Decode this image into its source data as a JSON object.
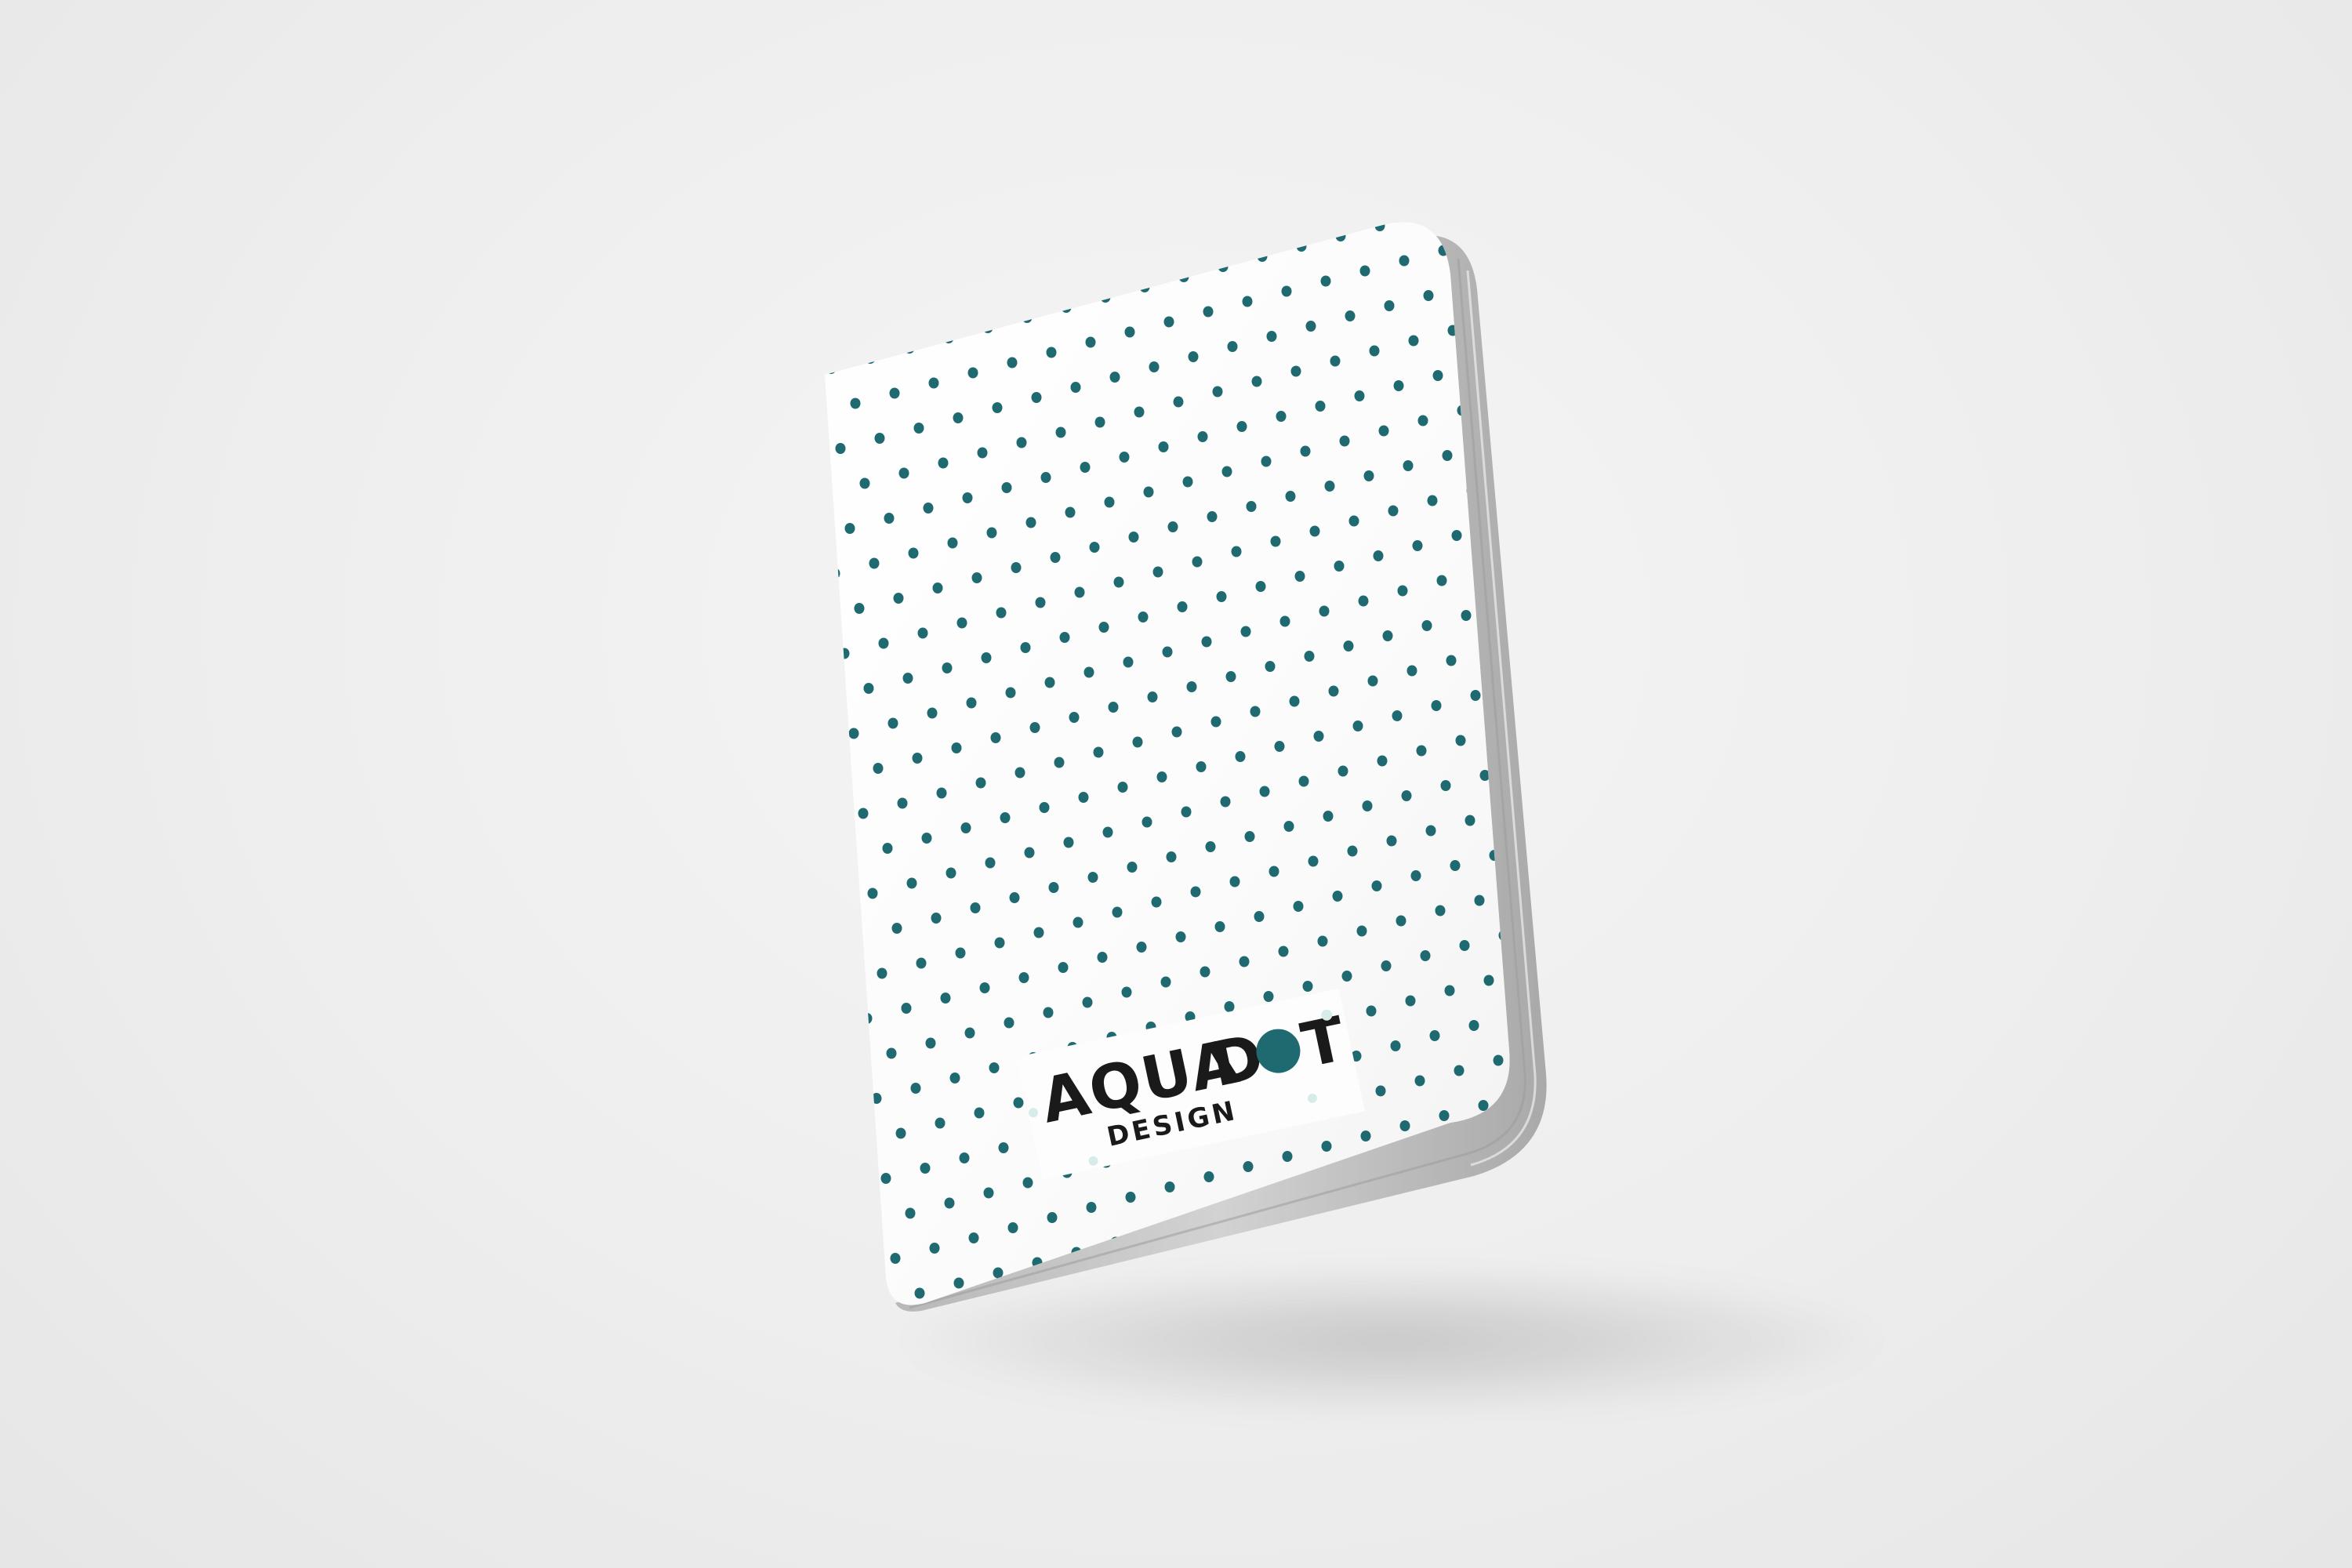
{
  "product": {
    "type": "notebook",
    "pattern_color": "#1f6a71",
    "cover_color": "#fdfdfd",
    "page_edge_color": "#c4c4c4",
    "background_color": "#eeeeee"
  },
  "logo": {
    "word_aqua": "AQUA",
    "word_dot": "D",
    "word_dot_end": "T",
    "word_design": "DESIGN",
    "text_color": "#1a1a1a",
    "accent_color": "#1f6a71",
    "sparkle_color": "#d7ece9"
  }
}
